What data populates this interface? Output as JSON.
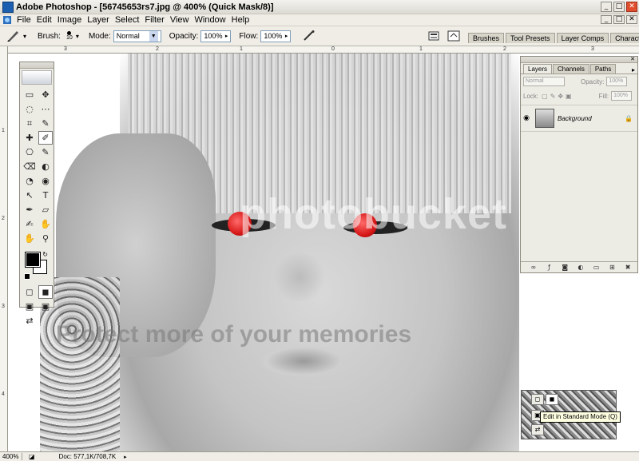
{
  "app": {
    "title": "Adobe Photoshop - [56745653rs7.jpg @ 400% (Quick Mask/8)]"
  },
  "window_controls": [
    "_",
    "□",
    "✕"
  ],
  "document_controls": [
    "_",
    "□",
    "✕"
  ],
  "menu": [
    "File",
    "Edit",
    "Image",
    "Layer",
    "Select",
    "Filter",
    "View",
    "Window",
    "Help"
  ],
  "options": {
    "brush_label": "Brush:",
    "brush_size": "10",
    "mode_label": "Mode:",
    "mode_value": "Normal",
    "opacity_label": "Opacity:",
    "opacity_value": "100%",
    "flow_label": "Flow:",
    "flow_value": "100%"
  },
  "palette_well": [
    "Brushes",
    "Tool Presets",
    "Layer Comps",
    "Character"
  ],
  "rulers": {
    "h_ticks": [
      "3",
      "2",
      "1",
      "0",
      "1",
      "2",
      "3"
    ],
    "v_ticks": [
      "1",
      "2",
      "3",
      "4"
    ]
  },
  "canvas": {
    "watermark_top": "photobucket",
    "watermark_bottom": "Protect more of your memories"
  },
  "toolbox": {
    "tools": [
      "▭",
      "✥",
      "◌",
      "⋯",
      "⌗",
      "✎",
      "✚",
      "✐",
      "⎔",
      "✎",
      "⌫",
      "◐",
      "◔",
      "◉",
      "↖",
      "T",
      "✒",
      "▱",
      "✍",
      "✋",
      "✋",
      "⚲",
      "",
      "",
      "◻",
      "◼",
      "▣",
      "▣",
      "⇄",
      ""
    ]
  },
  "layers_panel": {
    "tabs": [
      "Layers",
      "Channels",
      "Paths"
    ],
    "blend_mode": "Normal",
    "opacity_label": "Opacity:",
    "opacity_value": "100%",
    "lock_label": "Lock:",
    "fill_label": "Fill:",
    "fill_value": "100%",
    "layers": [
      {
        "name": "Background",
        "visible": true,
        "locked": true
      }
    ],
    "footer_icons": [
      "link-icon",
      "fx-icon",
      "mask-icon",
      "adjustment-icon",
      "folder-icon",
      "new-layer-icon",
      "trash-icon"
    ]
  },
  "tooltip": "Edit in Standard Mode (Q)",
  "status": {
    "zoom": "400%",
    "doc": "Doc: 577,1K/708,7K"
  }
}
